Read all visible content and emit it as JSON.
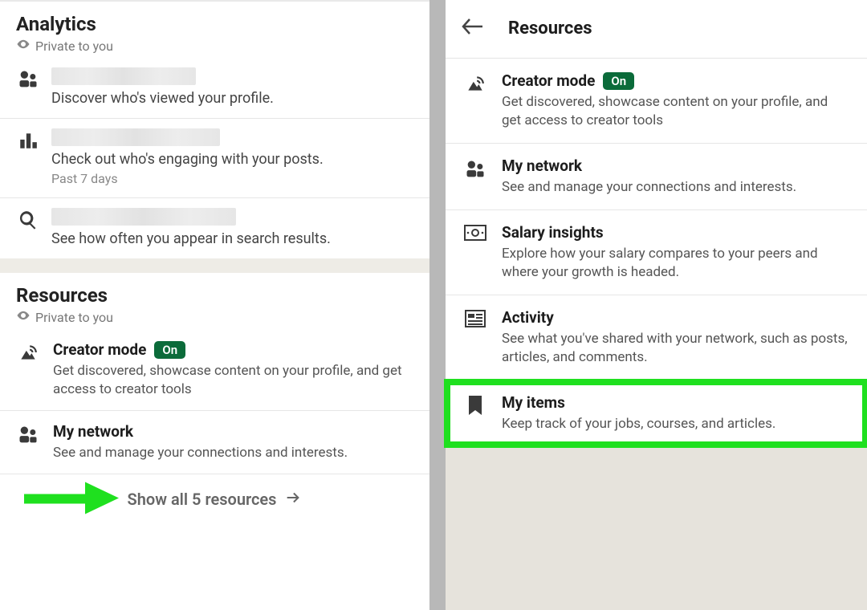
{
  "left": {
    "analytics": {
      "heading": "Analytics",
      "privacy": "Private to you",
      "rows": [
        {
          "desc": "Discover who's viewed your profile."
        },
        {
          "desc": "Check out who's engaging with your posts.",
          "sub": "Past 7 days"
        },
        {
          "desc": "See how often you appear in search results."
        }
      ]
    },
    "resources": {
      "heading": "Resources",
      "privacy": "Private to you",
      "creator": {
        "title": "Creator mode",
        "badge": "On",
        "desc": "Get discovered, showcase content on your profile, and get access to creator tools"
      },
      "network": {
        "title": "My network",
        "desc": "See and manage your connections and interests."
      },
      "show_all": "Show all 5 resources"
    }
  },
  "right": {
    "heading": "Resources",
    "creator": {
      "title": "Creator mode",
      "badge": "On",
      "desc": "Get discovered, showcase content on your profile, and get access to creator tools"
    },
    "network": {
      "title": "My network",
      "desc": "See and manage your connections and interests."
    },
    "salary": {
      "title": "Salary insights",
      "desc": "Explore how your salary compares to your peers and where your growth is headed."
    },
    "activity": {
      "title": "Activity",
      "desc": "See what you've shared with your network, such as posts, articles, and comments."
    },
    "myitems": {
      "title": "My items",
      "desc": "Keep track of your jobs, courses, and articles."
    }
  }
}
